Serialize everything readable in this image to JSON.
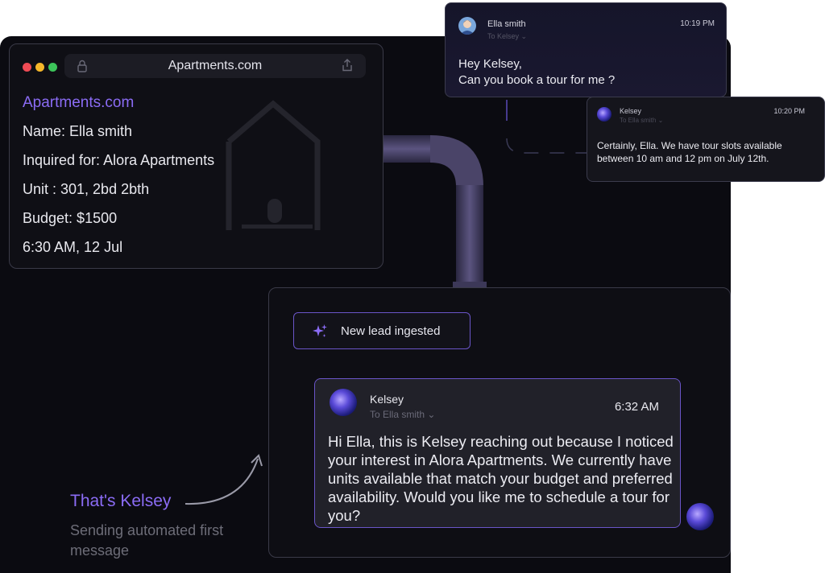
{
  "lead_card": {
    "url": "Apartments.com",
    "site_title": "Apartments.com",
    "name": "Name: Ella smith",
    "inquired": "Inquired for: Alora Apartments",
    "unit": "Unit :  301, 2bd 2bth",
    "budget": "Budget: $1500",
    "time": "6:30 AM, 12 Jul"
  },
  "pill": {
    "label": "New lead ingested"
  },
  "message": {
    "sender": "Kelsey",
    "to": "To Ella smith",
    "time": "6:32 AM",
    "body": "Hi Ella, this is Kelsey reaching out because I noticed your interest in Alora Apartments. We currently have units available that match your budget and preferred availability. Would you like me to schedule a tour for you?"
  },
  "caption": {
    "title": "That's Kelsey",
    "subtitle": "Sending automated first message"
  },
  "chat_ella": {
    "sender": "Ella smith",
    "to": "To Kelsey",
    "time": "10:19 PM",
    "line1": "Hey Kelsey,",
    "line2": "Can you book a tour for me ?"
  },
  "chat_kelsey": {
    "sender": "Kelsey",
    "to": "To Ella smith",
    "time": "10:20 PM",
    "body": "Certainly, Ella. We have tour slots available between 10 am and 12 pm on July 12th."
  },
  "colors": {
    "accent": "#8b6cf5",
    "panel": "#0b0b11",
    "traffic_red": "#ef4b55",
    "traffic_yellow": "#f5b72a",
    "traffic_green": "#3cc45a"
  }
}
